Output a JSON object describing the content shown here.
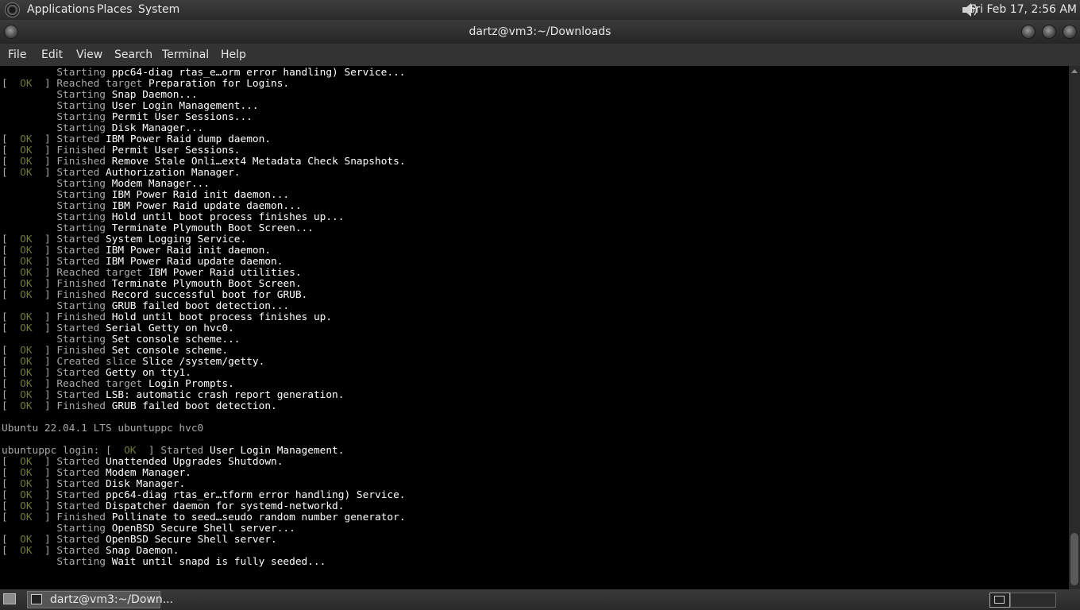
{
  "top_panel": {
    "menus": [
      "Applications",
      "Places",
      "System"
    ],
    "clock": "Fri Feb 17,  2:56 AM",
    "icons": {
      "logo": "distro-logo-icon",
      "volume": "speaker-icon"
    }
  },
  "window": {
    "title": "dartz@vm3:~/Downloads",
    "menus": [
      "File",
      "Edit",
      "View",
      "Search",
      "Terminal",
      "Help"
    ]
  },
  "colors": {
    "ok_status": "#6f7a35",
    "terminal_bg": "#000000",
    "panel_bg": "#333333"
  },
  "terminal": {
    "lines": [
      [
        {
          "t": "         Starting ",
          "c": "dim"
        },
        {
          "t": "ppc64-diag rtas_e…orm error handling) Service...",
          "c": "hi"
        }
      ],
      [
        {
          "t": "[  ",
          "c": "dim"
        },
        {
          "t": "OK",
          "c": "ok"
        },
        {
          "t": "  ] Reached target ",
          "c": "dim"
        },
        {
          "t": "Preparation for Logins.",
          "c": "hi"
        }
      ],
      [
        {
          "t": "         Starting ",
          "c": "dim"
        },
        {
          "t": "Snap Daemon...",
          "c": "hi"
        }
      ],
      [
        {
          "t": "         Starting ",
          "c": "dim"
        },
        {
          "t": "User Login Management...",
          "c": "hi"
        }
      ],
      [
        {
          "t": "         Starting ",
          "c": "dim"
        },
        {
          "t": "Permit User Sessions...",
          "c": "hi"
        }
      ],
      [
        {
          "t": "         Starting ",
          "c": "dim"
        },
        {
          "t": "Disk Manager...",
          "c": "hi"
        }
      ],
      [
        {
          "t": "[  ",
          "c": "dim"
        },
        {
          "t": "OK",
          "c": "ok"
        },
        {
          "t": "  ] Started ",
          "c": "dim"
        },
        {
          "t": "IBM Power Raid dump daemon.",
          "c": "hi"
        }
      ],
      [
        {
          "t": "[  ",
          "c": "dim"
        },
        {
          "t": "OK",
          "c": "ok"
        },
        {
          "t": "  ] Finished ",
          "c": "dim"
        },
        {
          "t": "Permit User Sessions.",
          "c": "hi"
        }
      ],
      [
        {
          "t": "[  ",
          "c": "dim"
        },
        {
          "t": "OK",
          "c": "ok"
        },
        {
          "t": "  ] Finished ",
          "c": "dim"
        },
        {
          "t": "Remove Stale Onli…ext4 Metadata Check Snapshots.",
          "c": "hi"
        }
      ],
      [
        {
          "t": "[  ",
          "c": "dim"
        },
        {
          "t": "OK",
          "c": "ok"
        },
        {
          "t": "  ] Started ",
          "c": "dim"
        },
        {
          "t": "Authorization Manager.",
          "c": "hi"
        }
      ],
      [
        {
          "t": "         Starting ",
          "c": "dim"
        },
        {
          "t": "Modem Manager...",
          "c": "hi"
        }
      ],
      [
        {
          "t": "         Starting ",
          "c": "dim"
        },
        {
          "t": "IBM Power Raid init daemon...",
          "c": "hi"
        }
      ],
      [
        {
          "t": "         Starting ",
          "c": "dim"
        },
        {
          "t": "IBM Power Raid update daemon...",
          "c": "hi"
        }
      ],
      [
        {
          "t": "         Starting ",
          "c": "dim"
        },
        {
          "t": "Hold until boot process finishes up...",
          "c": "hi"
        }
      ],
      [
        {
          "t": "         Starting ",
          "c": "dim"
        },
        {
          "t": "Terminate Plymouth Boot Screen...",
          "c": "hi"
        }
      ],
      [
        {
          "t": "[  ",
          "c": "dim"
        },
        {
          "t": "OK",
          "c": "ok"
        },
        {
          "t": "  ] Started ",
          "c": "dim"
        },
        {
          "t": "System Logging Service.",
          "c": "hi"
        }
      ],
      [
        {
          "t": "[  ",
          "c": "dim"
        },
        {
          "t": "OK",
          "c": "ok"
        },
        {
          "t": "  ] Started ",
          "c": "dim"
        },
        {
          "t": "IBM Power Raid init daemon.",
          "c": "hi"
        }
      ],
      [
        {
          "t": "[  ",
          "c": "dim"
        },
        {
          "t": "OK",
          "c": "ok"
        },
        {
          "t": "  ] Started ",
          "c": "dim"
        },
        {
          "t": "IBM Power Raid update daemon.",
          "c": "hi"
        }
      ],
      [
        {
          "t": "[  ",
          "c": "dim"
        },
        {
          "t": "OK",
          "c": "ok"
        },
        {
          "t": "  ] Reached target ",
          "c": "dim"
        },
        {
          "t": "IBM Power Raid utilities.",
          "c": "hi"
        }
      ],
      [
        {
          "t": "[  ",
          "c": "dim"
        },
        {
          "t": "OK",
          "c": "ok"
        },
        {
          "t": "  ] Finished ",
          "c": "dim"
        },
        {
          "t": "Terminate Plymouth Boot Screen.",
          "c": "hi"
        }
      ],
      [
        {
          "t": "[  ",
          "c": "dim"
        },
        {
          "t": "OK",
          "c": "ok"
        },
        {
          "t": "  ] Finished ",
          "c": "dim"
        },
        {
          "t": "Record successful boot for GRUB.",
          "c": "hi"
        }
      ],
      [
        {
          "t": "         Starting ",
          "c": "dim"
        },
        {
          "t": "GRUB failed boot detection...",
          "c": "hi"
        }
      ],
      [
        {
          "t": "[  ",
          "c": "dim"
        },
        {
          "t": "OK",
          "c": "ok"
        },
        {
          "t": "  ] Finished ",
          "c": "dim"
        },
        {
          "t": "Hold until boot process finishes up.",
          "c": "hi"
        }
      ],
      [
        {
          "t": "[  ",
          "c": "dim"
        },
        {
          "t": "OK",
          "c": "ok"
        },
        {
          "t": "  ] Started ",
          "c": "dim"
        },
        {
          "t": "Serial Getty on hvc0.",
          "c": "hi"
        }
      ],
      [
        {
          "t": "         Starting ",
          "c": "dim"
        },
        {
          "t": "Set console scheme...",
          "c": "hi"
        }
      ],
      [
        {
          "t": "[  ",
          "c": "dim"
        },
        {
          "t": "OK",
          "c": "ok"
        },
        {
          "t": "  ] Finished ",
          "c": "dim"
        },
        {
          "t": "Set console scheme.",
          "c": "hi"
        }
      ],
      [
        {
          "t": "[  ",
          "c": "dim"
        },
        {
          "t": "OK",
          "c": "ok"
        },
        {
          "t": "  ] Created slice ",
          "c": "dim"
        },
        {
          "t": "Slice /system/getty.",
          "c": "hi"
        }
      ],
      [
        {
          "t": "[  ",
          "c": "dim"
        },
        {
          "t": "OK",
          "c": "ok"
        },
        {
          "t": "  ] Started ",
          "c": "dim"
        },
        {
          "t": "Getty on tty1.",
          "c": "hi"
        }
      ],
      [
        {
          "t": "[  ",
          "c": "dim"
        },
        {
          "t": "OK",
          "c": "ok"
        },
        {
          "t": "  ] Reached target ",
          "c": "dim"
        },
        {
          "t": "Login Prompts.",
          "c": "hi"
        }
      ],
      [
        {
          "t": "[  ",
          "c": "dim"
        },
        {
          "t": "OK",
          "c": "ok"
        },
        {
          "t": "  ] Started ",
          "c": "dim"
        },
        {
          "t": "LSB: automatic crash report generation.",
          "c": "hi"
        }
      ],
      [
        {
          "t": "[  ",
          "c": "dim"
        },
        {
          "t": "OK",
          "c": "ok"
        },
        {
          "t": "  ] Finished ",
          "c": "dim"
        },
        {
          "t": "GRUB failed boot detection.",
          "c": "hi"
        }
      ],
      [],
      [
        {
          "t": "Ubuntu 22.04.1 LTS ubuntuppc hvc0",
          "c": "dim"
        }
      ],
      [],
      [
        {
          "t": "ubuntuppc login: [  ",
          "c": "dim"
        },
        {
          "t": "OK",
          "c": "ok"
        },
        {
          "t": "  ] Started ",
          "c": "dim"
        },
        {
          "t": "User Login Management.",
          "c": "hi"
        }
      ],
      [
        {
          "t": "[  ",
          "c": "dim"
        },
        {
          "t": "OK",
          "c": "ok"
        },
        {
          "t": "  ] Started ",
          "c": "dim"
        },
        {
          "t": "Unattended Upgrades Shutdown.",
          "c": "hi"
        }
      ],
      [
        {
          "t": "[  ",
          "c": "dim"
        },
        {
          "t": "OK",
          "c": "ok"
        },
        {
          "t": "  ] Started ",
          "c": "dim"
        },
        {
          "t": "Modem Manager.",
          "c": "hi"
        }
      ],
      [
        {
          "t": "[  ",
          "c": "dim"
        },
        {
          "t": "OK",
          "c": "ok"
        },
        {
          "t": "  ] Started ",
          "c": "dim"
        },
        {
          "t": "Disk Manager.",
          "c": "hi"
        }
      ],
      [
        {
          "t": "[  ",
          "c": "dim"
        },
        {
          "t": "OK",
          "c": "ok"
        },
        {
          "t": "  ] Started ",
          "c": "dim"
        },
        {
          "t": "ppc64-diag rtas_er…tform error handling) Service.",
          "c": "hi"
        }
      ],
      [
        {
          "t": "[  ",
          "c": "dim"
        },
        {
          "t": "OK",
          "c": "ok"
        },
        {
          "t": "  ] Started ",
          "c": "dim"
        },
        {
          "t": "Dispatcher daemon for systemd-networkd.",
          "c": "hi"
        }
      ],
      [
        {
          "t": "[  ",
          "c": "dim"
        },
        {
          "t": "OK",
          "c": "ok"
        },
        {
          "t": "  ] Finished ",
          "c": "dim"
        },
        {
          "t": "Pollinate to seed…seudo random number generator.",
          "c": "hi"
        }
      ],
      [
        {
          "t": "         Starting ",
          "c": "dim"
        },
        {
          "t": "OpenBSD Secure Shell server...",
          "c": "hi"
        }
      ],
      [
        {
          "t": "[  ",
          "c": "dim"
        },
        {
          "t": "OK",
          "c": "ok"
        },
        {
          "t": "  ] Started ",
          "c": "dim"
        },
        {
          "t": "OpenBSD Secure Shell server.",
          "c": "hi"
        }
      ],
      [
        {
          "t": "[  ",
          "c": "dim"
        },
        {
          "t": "OK",
          "c": "ok"
        },
        {
          "t": "  ] Started ",
          "c": "dim"
        },
        {
          "t": "Snap Daemon.",
          "c": "hi"
        }
      ],
      [
        {
          "t": "         Starting ",
          "c": "dim"
        },
        {
          "t": "Wait until snapd is fully seeded...",
          "c": "hi"
        }
      ]
    ]
  },
  "bottom_panel": {
    "task_label": "dartz@vm3:~/Down...",
    "icons": {
      "show_desktop": "show-desktop-icon",
      "task": "terminal-icon",
      "workspace": "workspace-switcher-icon"
    }
  }
}
